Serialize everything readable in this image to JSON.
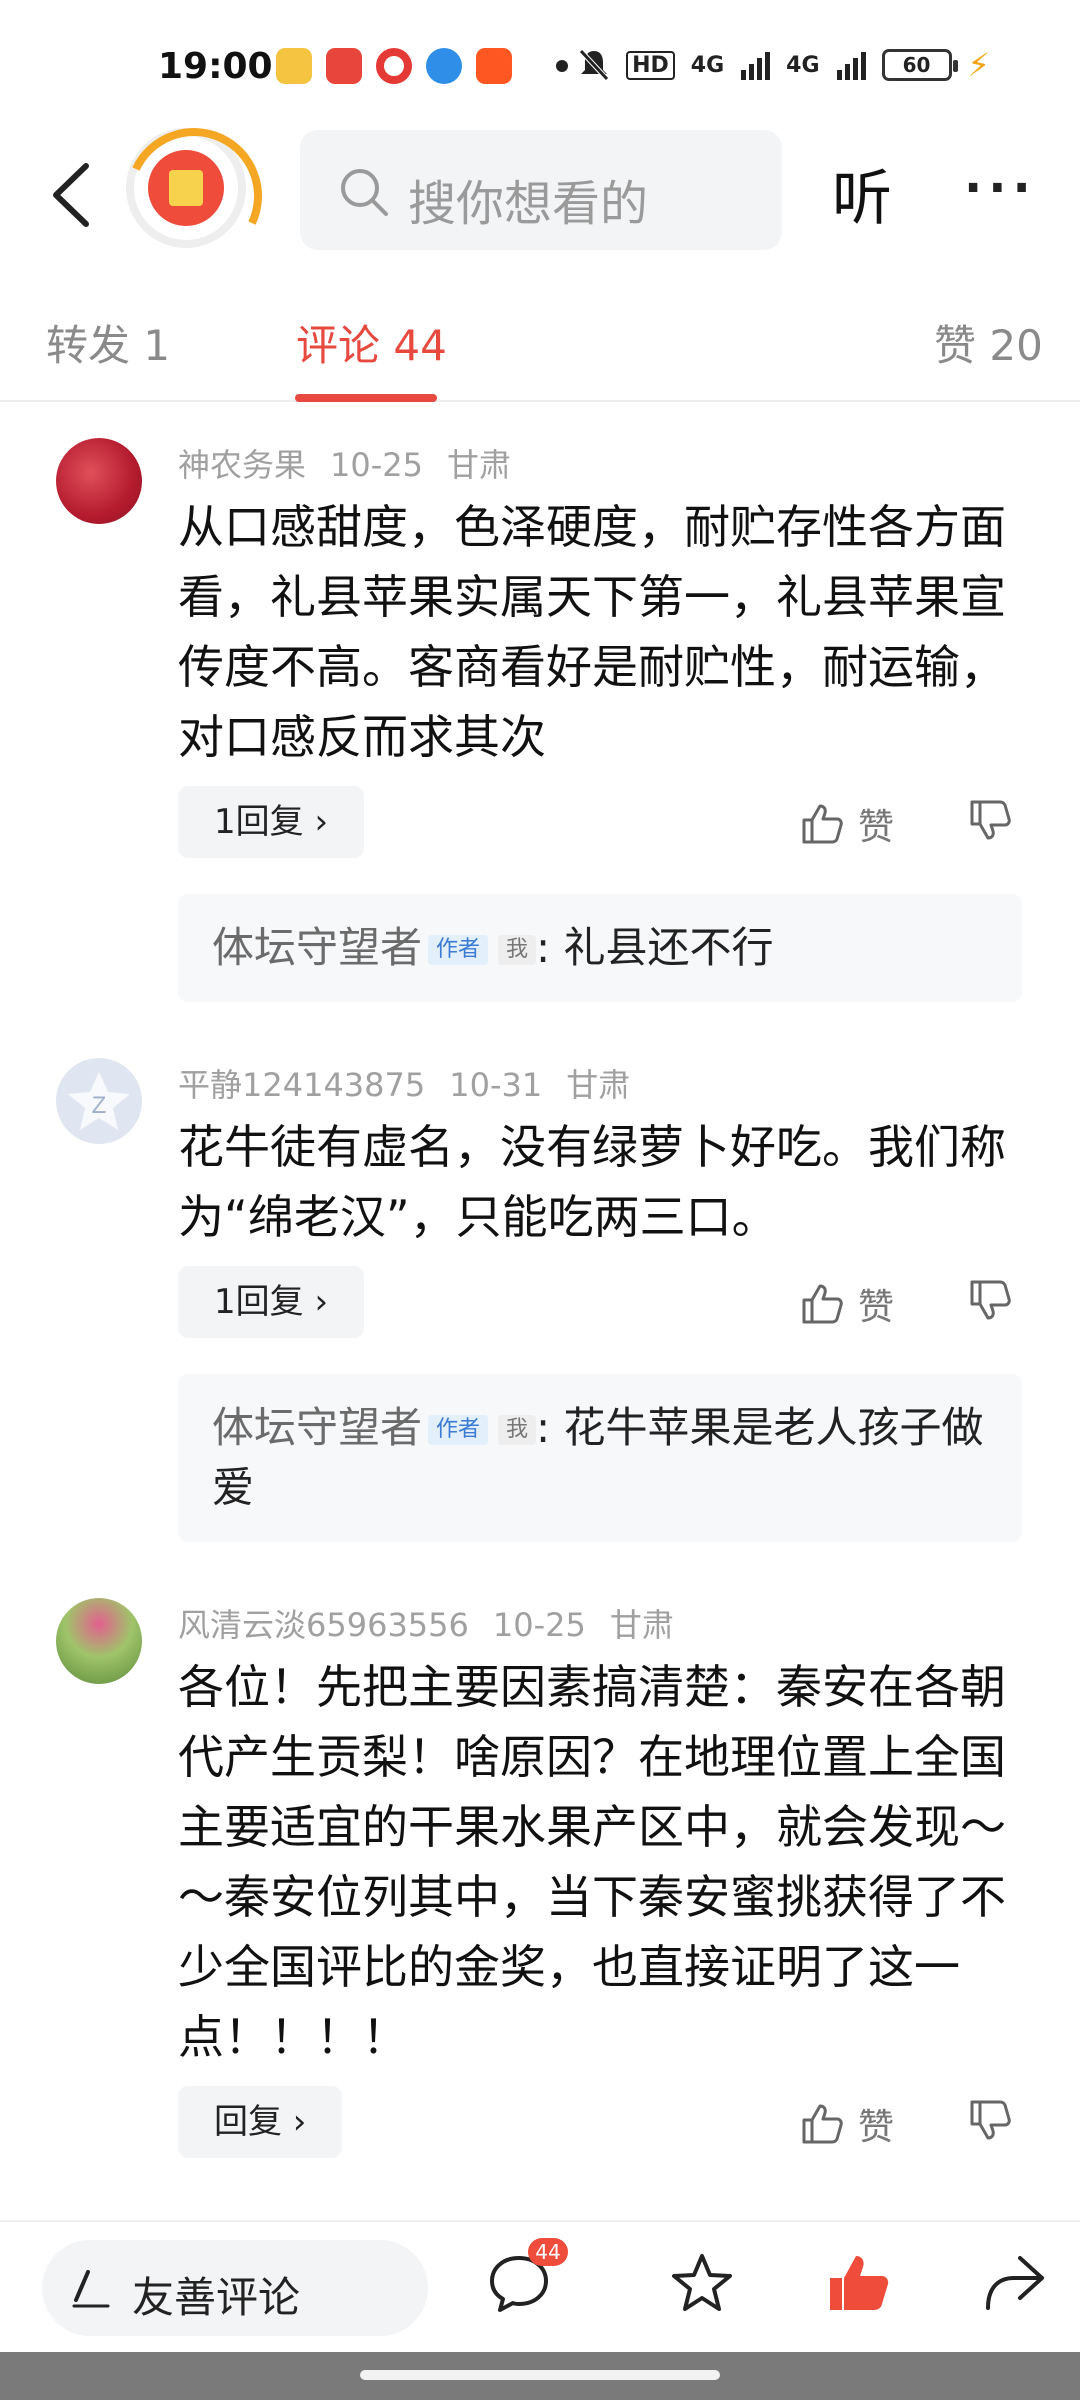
{
  "status_bar": {
    "time": "19:00",
    "network": "HD",
    "signal1": "4G",
    "signal2": "4G",
    "battery": "60"
  },
  "header": {
    "search_placeholder": "搜你想看的",
    "listen_label": "听",
    "more_label": "···"
  },
  "tabs": {
    "repost": "转发 1",
    "comments": "评论 44",
    "likes": "赞 20"
  },
  "comments": [
    {
      "user": "神农务果",
      "date": "10-25",
      "location": "甘肃",
      "text": "从口感甜度，色泽硬度，耐贮存性各方面看，礼县苹果实属天下第一，礼县苹果宣传度不高。客商看好是耐贮性，耐运输，对口感反而求其次",
      "reply_label": "1回复 ›",
      "like_label": "赞",
      "author_reply": {
        "name": "体坛守望者",
        "badge_author": "作者",
        "badge_me": "我",
        "text": ": 礼县还不行"
      }
    },
    {
      "user": "平静124143875",
      "date": "10-31",
      "location": "甘肃",
      "text": "花牛徒有虚名，没有绿萝卜好吃。我们称为“绵老汉”，只能吃两三口。",
      "reply_label": "1回复 ›",
      "like_label": "赞",
      "author_reply": {
        "name": "体坛守望者",
        "badge_author": "作者",
        "badge_me": "我",
        "text": ": 花牛苹果是老人孩子做爱"
      }
    },
    {
      "user": "风清云淡65963556",
      "date": "10-25",
      "location": "甘肃",
      "text": "各位！先把主要因素搞清楚：秦安在各朝代产生贡梨！啥原因？在地理位置上全国主要适宜的干果水果产区中，就会发现～～秦安位列其中，当下秦安蜜挑获得了不少全国评比的金奖，也直接证明了这一点！！！！",
      "reply_label": "回复 ›",
      "like_label": "赞"
    }
  ],
  "bottom_bar": {
    "comment_placeholder": "友善评论",
    "comment_count": "44"
  }
}
